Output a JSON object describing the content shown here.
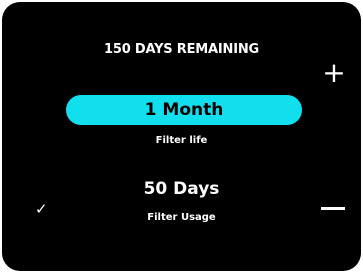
{
  "header": {
    "remaining_text": "150 DAYS REMAINING"
  },
  "selected_option": {
    "value": "1 Month",
    "label": "Filter life"
  },
  "current_option": {
    "value": "50 Days",
    "label": "Filter Usage"
  },
  "controls": {
    "increase_symbol": "+",
    "checkmark_symbol": "✓",
    "decrease_icon": "minus-icon"
  },
  "colors": {
    "highlight": "#11dfee",
    "background": "#000000",
    "text": "#ffffff"
  }
}
